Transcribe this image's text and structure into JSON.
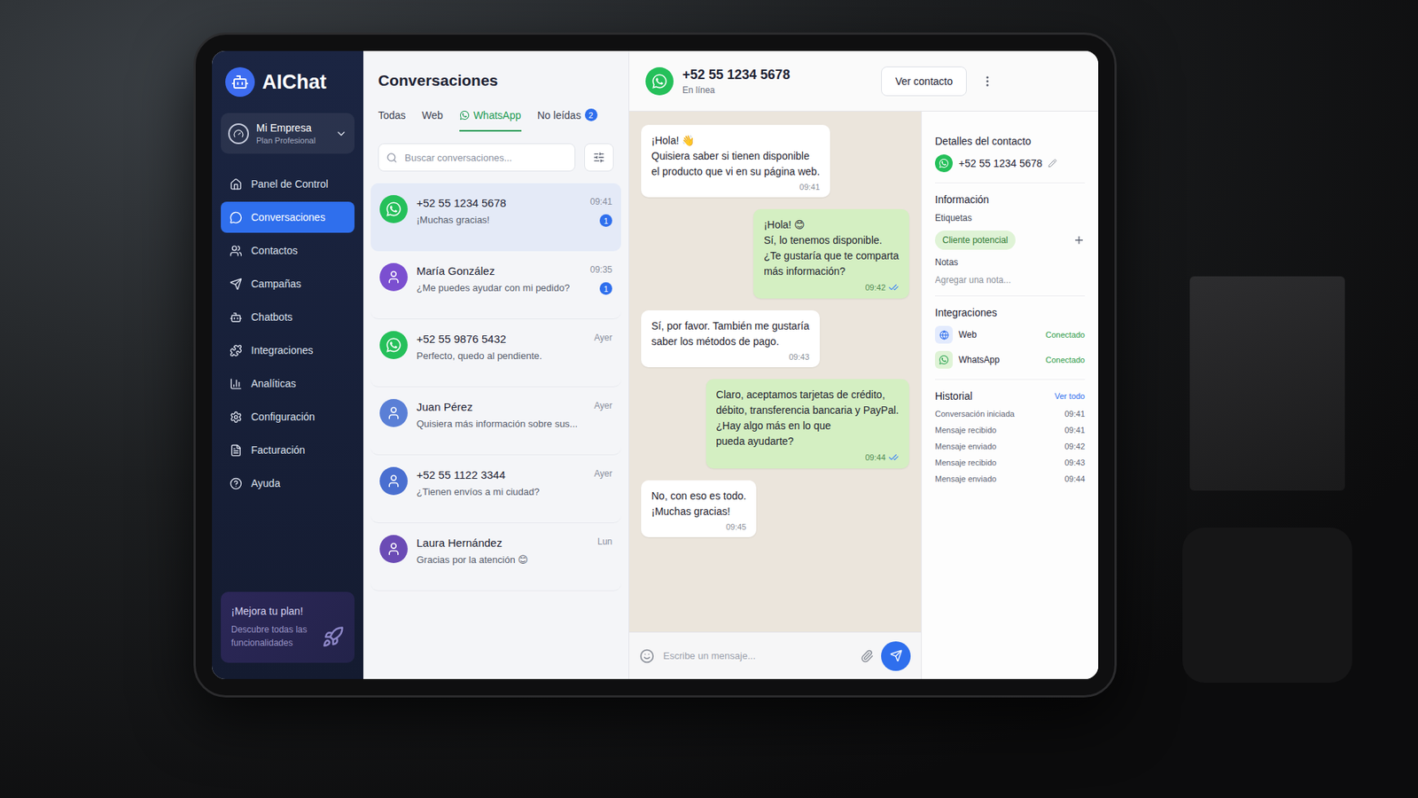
{
  "app": {
    "logo": "AIChat",
    "company": {
      "name": "Mi Empresa",
      "plan": "Plan Profesional"
    }
  },
  "sidebar": {
    "items": [
      {
        "label": "Panel de Control",
        "selected": false
      },
      {
        "label": "Conversaciones",
        "selected": true
      },
      {
        "label": "Contactos",
        "selected": false
      },
      {
        "label": "Campañas",
        "selected": false
      },
      {
        "label": "Chatbots",
        "selected": false
      },
      {
        "label": "Integraciones",
        "selected": false
      },
      {
        "label": "Analíticas",
        "selected": false
      },
      {
        "label": "Configuración",
        "selected": false
      },
      {
        "label": "Facturación",
        "selected": false
      },
      {
        "label": "Ayuda",
        "selected": false
      }
    ],
    "upgrade": {
      "title": "¡Mejora tu plan!",
      "text": "Descubre todas las funcionalidades"
    }
  },
  "conversations": {
    "title": "Conversaciones",
    "tabs": [
      {
        "label": "Todas",
        "selected": false,
        "kind": "plain",
        "badge": null
      },
      {
        "label": "Web",
        "selected": false,
        "kind": "plain",
        "badge": null
      },
      {
        "label": "WhatsApp",
        "selected": true,
        "kind": "whatsapp",
        "badge": null
      },
      {
        "label": "No leídas",
        "selected": false,
        "kind": "count",
        "badge": "2"
      }
    ],
    "search": {
      "placeholder": "Buscar conversaciones..."
    },
    "items": [
      {
        "name": "+52 55 1234 5678",
        "preview": "¡Muchas gracias!",
        "time": "09:41",
        "unread": "1",
        "selected": true,
        "kind": "whatsapp",
        "color": "#25c05a"
      },
      {
        "name": "María González",
        "preview": "¿Me puedes ayudar con mi pedido?",
        "time": "09:35",
        "unread": "1",
        "selected": false,
        "kind": "person",
        "color": "#7b4fd0"
      },
      {
        "name": "+52 55 9876 5432",
        "preview": "Perfecto, quedo al pendiente.",
        "time": "Ayer",
        "unread": null,
        "selected": false,
        "kind": "whatsapp",
        "color": "#25c05a"
      },
      {
        "name": "Juan Pérez",
        "preview": "Quisiera más información sobre sus...",
        "time": "Ayer",
        "unread": null,
        "selected": false,
        "kind": "person",
        "color": "#5a7fd6"
      },
      {
        "name": "+52 55 1122 3344",
        "preview": "¿Tienen envíos a mi ciudad?",
        "time": "Ayer",
        "unread": null,
        "selected": false,
        "kind": "person",
        "color": "#4a6fd0"
      },
      {
        "name": "Laura Hernández",
        "preview": "Gracias por la atención 😊",
        "time": "Lun",
        "unread": null,
        "selected": false,
        "kind": "person",
        "color": "#6b4bb5"
      }
    ]
  },
  "chat": {
    "contact": "+52 55 1234 5678",
    "status": "En línea",
    "button": "Ver contacto",
    "messages": [
      {
        "text": "¡Hola! 👋\nQuisiera saber si tienen disponible\nel producto que vi en su página web.",
        "time": "09:41",
        "outgoing": false,
        "read": false
      },
      {
        "text": "¡Hola! 😊\nSí, lo tenemos disponible.\n¿Te gustaría que te comparta\nmás información?",
        "time": "09:42",
        "outgoing": true,
        "read": true
      },
      {
        "text": "Sí, por favor. También me gustaría\nsaber los métodos de pago.",
        "time": "09:43",
        "outgoing": false,
        "read": false
      },
      {
        "text": "Claro, aceptamos tarjetas de crédito,\ndébito, transferencia bancaria y PayPal.\n¿Hay algo más en lo que\npueda ayudarte?",
        "time": "09:44",
        "outgoing": true,
        "read": true
      },
      {
        "text": "No, con eso es todo.\n¡Muchas gracias!",
        "time": "09:45",
        "outgoing": false,
        "read": false
      }
    ],
    "composer": {
      "placeholder": "Escribe un mensaje..."
    }
  },
  "details": {
    "title": "Detalles del contacto",
    "phone": "+52 55 1234 5678",
    "info": {
      "title": "Información",
      "tagsLabel": "Etiquetas",
      "tags": [
        "Cliente potencial"
      ],
      "notesLabel": "Notas",
      "notesPlaceholder": "Agregar una nota..."
    },
    "integrations": {
      "title": "Integraciones",
      "items": [
        {
          "name": "Web",
          "status": "Conectado",
          "kind": "web"
        },
        {
          "name": "WhatsApp",
          "status": "Conectado",
          "kind": "whatsapp"
        }
      ]
    },
    "history": {
      "title": "Historial",
      "link": "Ver todo",
      "items": [
        {
          "label": "Conversación iniciada",
          "time": "09:41"
        },
        {
          "label": "Mensaje recibido",
          "time": "09:41"
        },
        {
          "label": "Mensaje enviado",
          "time": "09:42"
        },
        {
          "label": "Mensaje recibido",
          "time": "09:43"
        },
        {
          "label": "Mensaje enviado",
          "time": "09:44"
        }
      ]
    }
  }
}
